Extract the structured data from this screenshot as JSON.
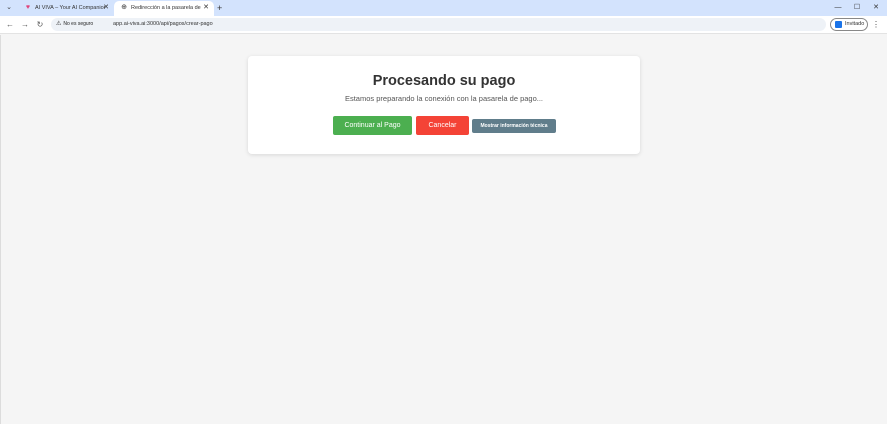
{
  "browser": {
    "tabs": [
      {
        "title": "AI VIVA – Your AI Companion f",
        "favicon": "heart-icon",
        "active": false
      },
      {
        "title": "Redirección a la pasarela de pa",
        "favicon": "globe-icon",
        "active": true
      }
    ],
    "security_label": "No es seguro",
    "url": "app.ai-viva.ai:3000/api/pagos/crear-pago",
    "profile_label": "Invitado"
  },
  "card": {
    "title": "Procesando su pago",
    "subtitle": "Estamos preparando la conexión con la pasarela de pago...",
    "buttons": {
      "continue": "Continuar al Pago",
      "cancel": "Cancelar",
      "technical": "Mostrar información técnica"
    }
  },
  "colors": {
    "continue": "#4caf50",
    "cancel": "#f44336",
    "technical": "#607d8b",
    "titlebar": "#d3e3fd"
  }
}
